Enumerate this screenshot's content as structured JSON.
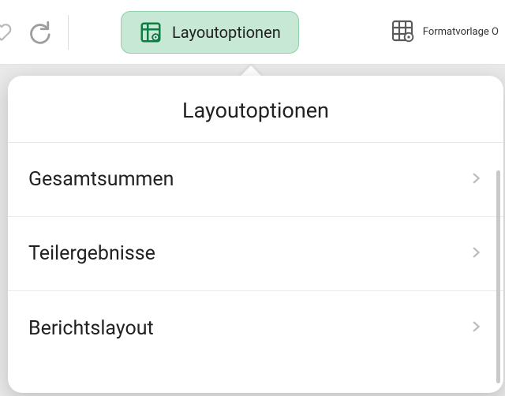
{
  "toolbar": {
    "layout_options_label": "Layoutoptionen",
    "style_template_label": "Formatvorlage O"
  },
  "popover": {
    "title": "Layoutoptionen",
    "items": [
      {
        "label": "Gesamtsummen"
      },
      {
        "label": "Teilergebnisse"
      },
      {
        "label": "Berichtslayout"
      }
    ]
  },
  "colors": {
    "accent_bg": "#c7e8d5",
    "accent_border": "#8fd0ab",
    "accent_icon": "#107c41"
  }
}
